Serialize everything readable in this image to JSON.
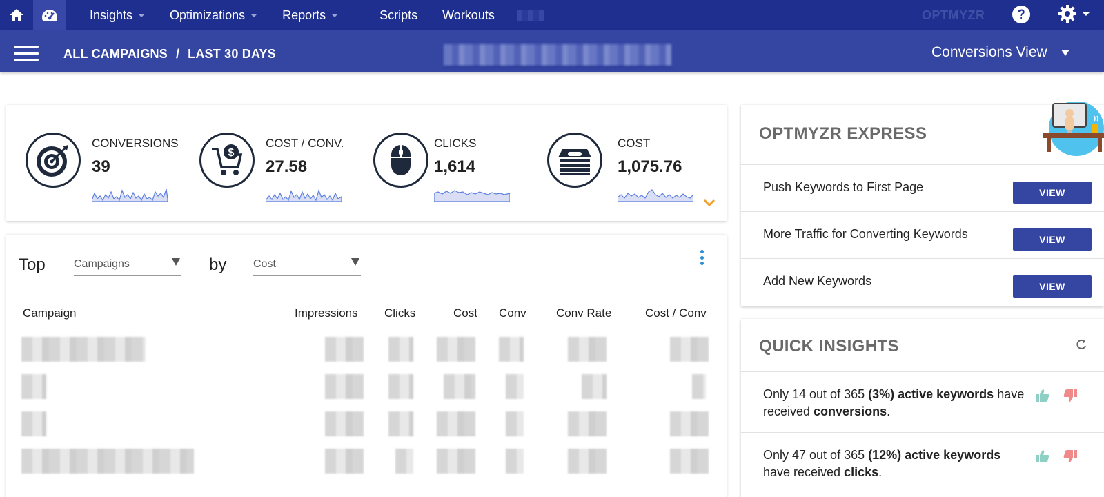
{
  "topnav": {
    "home_icon": "home-icon",
    "dashboard_icon": "speedometer-icon",
    "items": [
      {
        "label": "Insights",
        "has_caret": true
      },
      {
        "label": "Optimizations",
        "has_caret": true
      },
      {
        "label": "Reports",
        "has_caret": true
      },
      {
        "label": "Scripts",
        "has_caret": false
      },
      {
        "label": "Workouts",
        "has_caret": false
      }
    ],
    "brand": "OPTMYZR",
    "help_icon": "help-circle-icon",
    "settings_icon": "gear-icon"
  },
  "subheader": {
    "breadcrumb_campaigns": "ALL CAMPAIGNS",
    "breadcrumb_separator": "/",
    "breadcrumb_range": "LAST 30 DAYS",
    "view_selector": "Conversions View"
  },
  "metrics": [
    {
      "label": "CONVERSIONS",
      "value": "39",
      "icon": "target-icon"
    },
    {
      "label": "COST / CONV.",
      "value": "27.58",
      "icon": "shopping-cart-dollar-icon"
    },
    {
      "label": "CLICKS",
      "value": "1,614",
      "icon": "mouse-icon"
    },
    {
      "label": "COST",
      "value": "1,075.76",
      "icon": "money-stack-icon"
    }
  ],
  "top_table": {
    "top_label": "Top",
    "dimension_select": "Campaigns",
    "by_label": "by",
    "metric_select": "Cost",
    "columns": [
      "Campaign",
      "Impressions",
      "Clicks",
      "Cost",
      "Conv",
      "Conv Rate",
      "Cost / Conv"
    ]
  },
  "express": {
    "title": "OPTMYZR EXPRESS",
    "items": [
      {
        "label": "Push Keywords to First Page",
        "button": "VIEW"
      },
      {
        "label": "More Traffic for Converting Keywords",
        "button": "VIEW"
      },
      {
        "label": "Add New Keywords",
        "button": "VIEW"
      }
    ]
  },
  "insights": {
    "title": "QUICK INSIGHTS",
    "items": [
      {
        "pre": "Only 14 out of 365 ",
        "bold1": "(3%) active keywords",
        "mid": " have received ",
        "bold2": "conversions",
        "post": "."
      },
      {
        "pre": "Only 47 out of 365 ",
        "bold1": "(12%) active keywords",
        "mid": " have received ",
        "bold2": "clicks",
        "post": "."
      }
    ]
  },
  "colors": {
    "nav_bg": "#1f2f8f",
    "subheader_bg": "#3445a2",
    "button_bg": "#3445a2",
    "sparkline_stroke": "#5b7fe0",
    "sparkline_fill": "#d9def5",
    "thumbs_up": "#8fd0c4",
    "thumbs_down": "#f08a8a",
    "accent_orange": "#f0a030"
  }
}
